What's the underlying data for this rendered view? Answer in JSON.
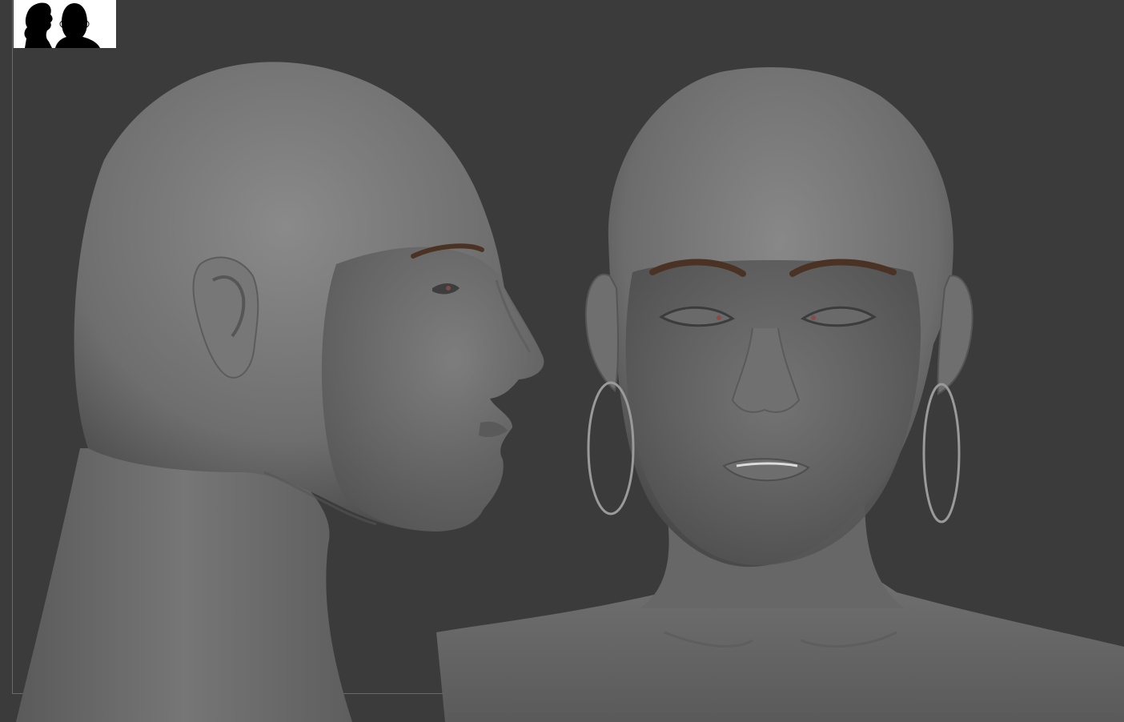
{
  "viewport": {
    "background": "#3b3b3b",
    "frame_color": "#6a6a6a"
  },
  "thumbnail": {
    "icon": "head-silhouettes-icon",
    "background": "#ffffff",
    "silhouette_color": "#000000"
  },
  "sculpt": {
    "material_color": "#7a7a7a",
    "views": [
      "side-profile",
      "front-view"
    ]
  }
}
